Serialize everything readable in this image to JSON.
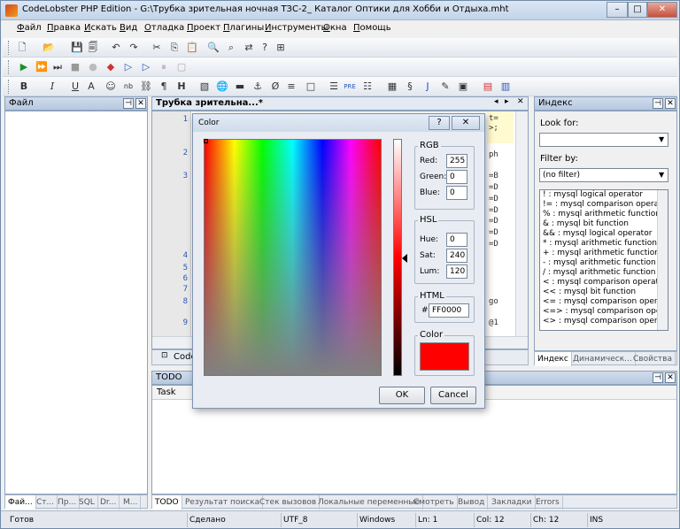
{
  "window": {
    "title": "CodeLobster PHP Edition - G:\\Трубка зрительная ночная ТЗС-2_ Каталог Оптики для Хобби и Отдыха.mht"
  },
  "window_buttons": {
    "minimize": "–",
    "maximize": "□",
    "close": "✕"
  },
  "menu": [
    "Файл",
    "Правка",
    "Искать",
    "Вид",
    "Отладка",
    "Проект",
    "Плагины",
    "Инструменты",
    "Окна",
    "Помощь"
  ],
  "left_panel": {
    "title": "Файл",
    "tabs": [
      "Фай...",
      "Ст...",
      "Пр...",
      "SQL",
      "Dr...",
      "M..."
    ]
  },
  "editor": {
    "tab_title": "Трубка зрительна...*",
    "line_numbers": [
      "1",
      "2",
      "3",
      "4",
      "5",
      "6",
      "7",
      "8",
      "9"
    ],
    "code_fragments": [
      "t=",
      ">;",
      "ph",
      "=B",
      "=D",
      "=D",
      "=D",
      "=D",
      "=D",
      "=D",
      "go",
      "@1"
    ],
    "bottom_tab": "Code"
  },
  "index_panel": {
    "title": "Индекс",
    "look_for_label": "Look for:",
    "look_for_value": "",
    "filter_label": "Filter by:",
    "filter_value": "(no filter)",
    "items": [
      "! : mysql logical operator",
      "!= : mysql comparison operator",
      "% : mysql arithmetic function",
      "& : mysql bit function",
      "&& : mysql logical operator",
      "* : mysql arithmetic function",
      "+ : mysql arithmetic function",
      "- : mysql arithmetic function",
      "/ : mysql arithmetic function",
      "< : mysql comparison operator",
      "<< : mysql bit function",
      "<= : mysql comparison operato",
      "<=> : mysql comparison operat",
      "<> : mysql comparison operato"
    ],
    "tabs": [
      "Индекс",
      "Динамическ...",
      "Свойства"
    ]
  },
  "todo_panel": {
    "title": "TODO",
    "column_task": "Task"
  },
  "bottom_tabs": [
    "TODO",
    "Результат поиска",
    "Стек вызовов",
    "Локальные переменные",
    "Смотреть",
    "Вывод",
    "Закладки",
    "Errors"
  ],
  "status_bar": [
    "Готов",
    "Сделано",
    "UTF_8",
    "Windows",
    "Ln: 1",
    "Col: 12",
    "Ch: 12",
    "INS"
  ],
  "color_dialog": {
    "title": "Color",
    "help_button": "?",
    "close_button": "✕",
    "rgb_title": "RGB",
    "red_label": "Red:",
    "red": "255",
    "green_label": "Green:",
    "green": "0",
    "blue_label": "Blue:",
    "blue": "0",
    "hsl_title": "HSL",
    "hue_label": "Hue:",
    "hue": "0",
    "sat_label": "Sat:",
    "sat": "240",
    "lum_label": "Lum:",
    "lum": "120",
    "html_title": "HTML",
    "hash": "#",
    "html_value": "FF0000",
    "color_title": "Color",
    "ok": "OK",
    "cancel": "Cancel",
    "swatch_color": "#ff0000"
  }
}
